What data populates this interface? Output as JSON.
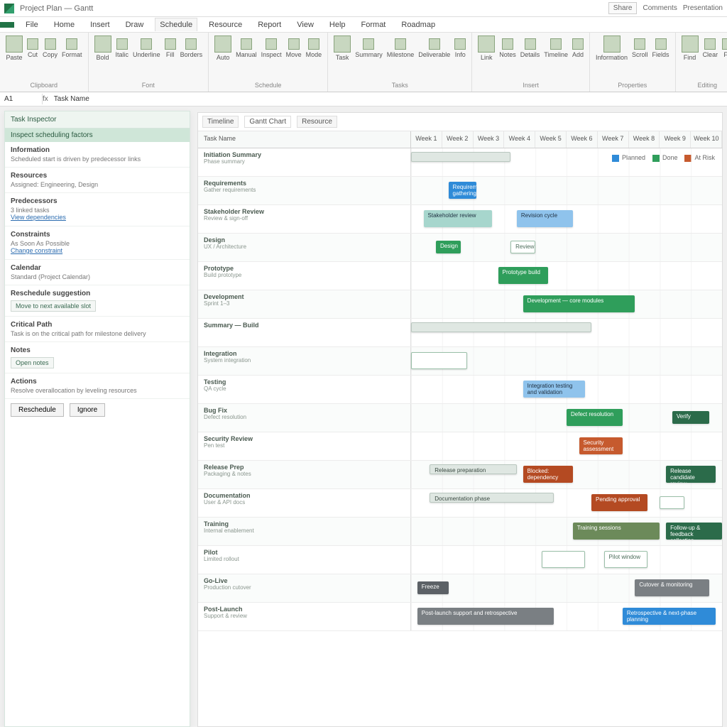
{
  "app": {
    "title": "Project Plan — Gantt",
    "share": "Share",
    "comments": "Comments",
    "present": "Presentation"
  },
  "ribbon": {
    "tabs": [
      "File",
      "Home",
      "Insert",
      "Draw",
      "Schedule",
      "Resource",
      "Report",
      "View",
      "Help",
      "Format",
      "Roadmap"
    ],
    "groups": [
      {
        "name": "Clipboard",
        "items": [
          "Paste",
          "Cut",
          "Copy",
          "Format"
        ]
      },
      {
        "name": "Font",
        "items": [
          "Bold",
          "Italic",
          "Underline",
          "Fill",
          "Borders"
        ]
      },
      {
        "name": "Schedule",
        "items": [
          "Auto",
          "Manual",
          "Inspect",
          "Move",
          "Mode"
        ]
      },
      {
        "name": "Tasks",
        "items": [
          "Task",
          "Summary",
          "Milestone",
          "Deliverable",
          "Info"
        ]
      },
      {
        "name": "Insert",
        "items": [
          "Link",
          "Notes",
          "Details",
          "Timeline",
          "Add"
        ]
      },
      {
        "name": "Properties",
        "items": [
          "Information",
          "Scroll",
          "Fields"
        ]
      },
      {
        "name": "Editing",
        "items": [
          "Find",
          "Clear",
          "Fill"
        ]
      }
    ]
  },
  "formula": {
    "name": "A1",
    "fx": "fx",
    "value": "Task Name"
  },
  "sidepanel": {
    "title": "Task Inspector",
    "band": "Inspect scheduling factors",
    "sections": [
      {
        "t": "Information",
        "d": "Scheduled start is driven by predecessor links"
      },
      {
        "t": "Resources",
        "d": "Assigned: Engineering, Design"
      },
      {
        "t": "Predecessors",
        "d": "3 linked tasks",
        "link": "View dependencies"
      },
      {
        "t": "Constraints",
        "d": "As Soon As Possible",
        "link": "Change constraint"
      },
      {
        "t": "Calendar",
        "d": "Standard (Project Calendar)"
      },
      {
        "t": "Reschedule suggestion",
        "chip": "Move to next available slot"
      },
      {
        "t": "Critical Path",
        "d": "Task is on the critical path for milestone delivery"
      },
      {
        "t": "Notes",
        "chip": "Open notes"
      },
      {
        "t": "Actions",
        "d": "Resolve overallocation by leveling resources"
      }
    ],
    "buttons": [
      "Reschedule",
      "Ignore"
    ]
  },
  "gantt": {
    "viewTabs": [
      "Timeline",
      "Gantt Chart",
      "Resource"
    ],
    "nameHeader": "Task Name",
    "timescale": [
      "Week 1",
      "Week 2",
      "Week 3",
      "Week 4",
      "Week 5",
      "Week 6",
      "Week 7",
      "Week 8",
      "Week 9",
      "Week 10"
    ],
    "legend": [
      {
        "label": "Planned",
        "color": "#2f8bd8"
      },
      {
        "label": "Done",
        "color": "#2f9e5b"
      },
      {
        "label": "At Risk",
        "color": "#c65a2e"
      }
    ],
    "rows": [
      {
        "name": "Initiation Summary",
        "detail": "Phase summary",
        "bars": [
          {
            "l": 0,
            "w": 32,
            "cls": "c-sum",
            "label": ""
          }
        ]
      },
      {
        "name": "Requirements",
        "detail": "Gather requirements",
        "bars": [
          {
            "l": 12,
            "w": 9,
            "cls": "c-blue",
            "label": "Requirements gathering"
          }
        ]
      },
      {
        "name": "Stakeholder Review",
        "detail": "Review & sign-off",
        "bars": [
          {
            "l": 4,
            "w": 22,
            "cls": "c-teal",
            "label": "Stakeholder review"
          },
          {
            "l": 34,
            "w": 18,
            "cls": "c-lblue",
            "label": "Revision cycle"
          }
        ]
      },
      {
        "name": "Design",
        "detail": "UX / Architecture",
        "bars": [
          {
            "l": 8,
            "w": 8,
            "cls": "c-green small",
            "label": "Design"
          },
          {
            "l": 32,
            "w": 8,
            "cls": "c-outline small",
            "label": "Review"
          }
        ]
      },
      {
        "name": "Prototype",
        "detail": "Build prototype",
        "bars": [
          {
            "l": 28,
            "w": 16,
            "cls": "c-green",
            "label": "Prototype build"
          }
        ]
      },
      {
        "name": "Development",
        "detail": "Sprint 1–3",
        "bars": [
          {
            "l": 36,
            "w": 36,
            "cls": "c-green",
            "label": "Development — core modules"
          }
        ]
      },
      {
        "name": "Summary — Build",
        "detail": "",
        "bars": [
          {
            "l": 0,
            "w": 58,
            "cls": "c-sum",
            "label": ""
          }
        ]
      },
      {
        "name": "Integration",
        "detail": "System integration",
        "bars": [
          {
            "l": 0,
            "w": 18,
            "cls": "c-outline",
            "label": ""
          }
        ]
      },
      {
        "name": "Testing",
        "detail": "QA cycle",
        "bars": [
          {
            "l": 36,
            "w": 20,
            "cls": "c-lblue",
            "label": "Integration testing and validation"
          }
        ]
      },
      {
        "name": "Bug Fix",
        "detail": "Defect resolution",
        "bars": [
          {
            "l": 50,
            "w": 18,
            "cls": "c-green",
            "label": "Defect resolution"
          },
          {
            "l": 84,
            "w": 12,
            "cls": "c-dgreen small",
            "label": "Verify"
          }
        ]
      },
      {
        "name": "Security Review",
        "detail": "Pen test",
        "bars": [
          {
            "l": 54,
            "w": 14,
            "cls": "c-orange",
            "label": "Security assessment"
          }
        ]
      },
      {
        "name": "Release Prep",
        "detail": "Packaging & notes",
        "bars": [
          {
            "l": 6,
            "w": 28,
            "cls": "c-sum",
            "label": "Release preparation"
          },
          {
            "l": 36,
            "w": 16,
            "cls": "c-dorange",
            "label": "Blocked: dependency"
          },
          {
            "l": 82,
            "w": 16,
            "cls": "c-dgreen",
            "label": "Release candidate review"
          }
        ]
      },
      {
        "name": "Documentation",
        "detail": "User & API docs",
        "bars": [
          {
            "l": 6,
            "w": 40,
            "cls": "c-sum",
            "label": "Documentation phase"
          },
          {
            "l": 58,
            "w": 18,
            "cls": "c-dorange",
            "label": "Pending approval"
          },
          {
            "l": 80,
            "w": 8,
            "cls": "c-outline small",
            "label": ""
          }
        ]
      },
      {
        "name": "Training",
        "detail": "Internal enablement",
        "bars": [
          {
            "l": 52,
            "w": 28,
            "cls": "c-olive",
            "label": "Training sessions"
          },
          {
            "l": 82,
            "w": 18,
            "cls": "c-dgreen",
            "label": "Follow-up & feedback collection"
          }
        ]
      },
      {
        "name": "Pilot",
        "detail": "Limited rollout",
        "bars": [
          {
            "l": 42,
            "w": 14,
            "cls": "c-outline",
            "label": ""
          },
          {
            "l": 62,
            "w": 14,
            "cls": "c-outline",
            "label": "Pilot window"
          }
        ]
      },
      {
        "name": "Go-Live",
        "detail": "Production cutover",
        "bars": [
          {
            "l": 2,
            "w": 10,
            "cls": "c-dgray small",
            "label": "Freeze"
          },
          {
            "l": 72,
            "w": 24,
            "cls": "c-gray",
            "label": "Cutover & monitoring"
          }
        ]
      },
      {
        "name": "Post-Launch",
        "detail": "Support & review",
        "bars": [
          {
            "l": 2,
            "w": 44,
            "cls": "c-gray",
            "label": "Post-launch support and retrospective"
          },
          {
            "l": 68,
            "w": 30,
            "cls": "c-blue",
            "label": "Retrospective & next-phase planning"
          }
        ]
      }
    ]
  }
}
